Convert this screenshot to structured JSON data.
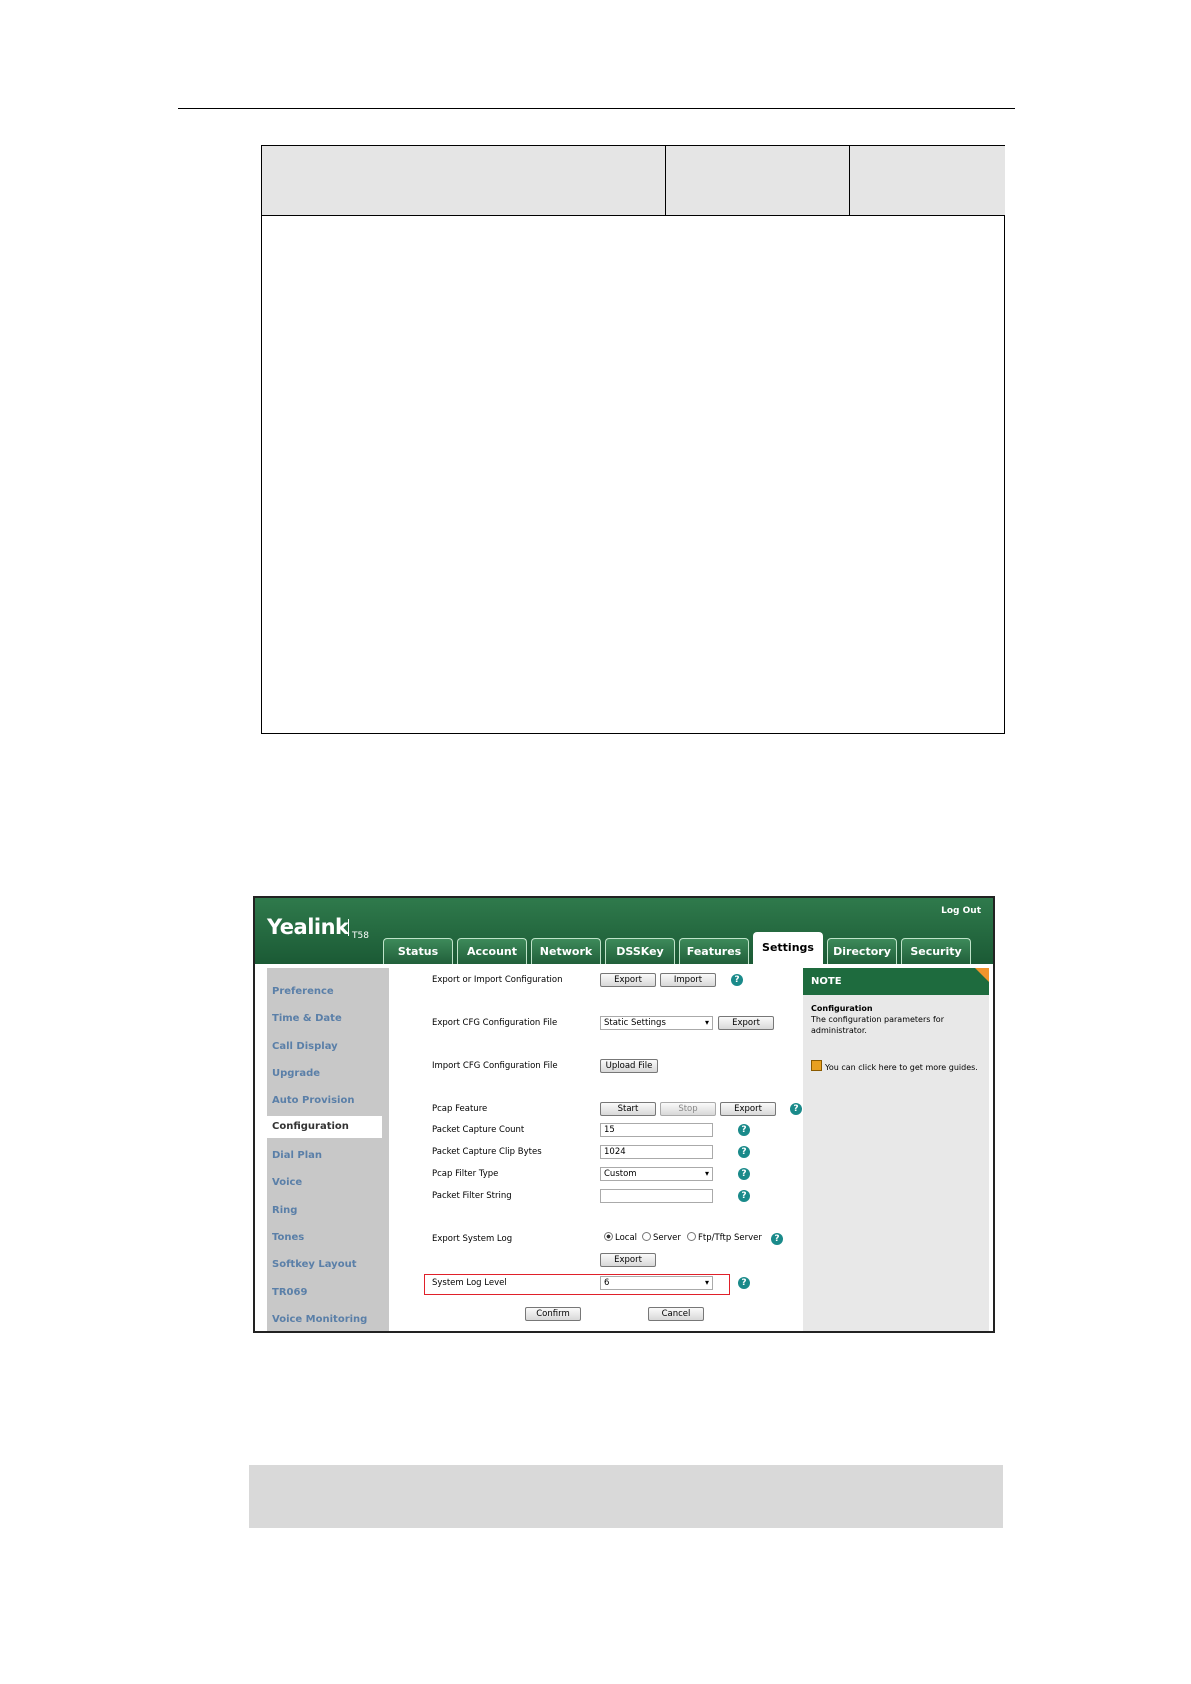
{
  "ui": {
    "logo": "Yealink",
    "model": "T58",
    "logout": "Log Out",
    "tabs": [
      "Status",
      "Account",
      "Network",
      "DSSKey",
      "Features",
      "Settings",
      "Directory",
      "Security"
    ],
    "active_tab": "Settings",
    "sidebar": [
      "Preference",
      "Time & Date",
      "Call Display",
      "Upgrade",
      "Auto Provision",
      "Configuration",
      "Dial Plan",
      "Voice",
      "Ring",
      "Tones",
      "Softkey Layout",
      "TR069",
      "Voice Monitoring"
    ],
    "active_sidebar": "Configuration",
    "rows": {
      "export_import_label": "Export or Import Configuration",
      "export_btn": "Export",
      "import_btn": "Import",
      "export_cfg_label": "Export CFG Configuration File",
      "export_cfg_select": "Static Settings",
      "export_cfg_btn": "Export",
      "import_cfg_label": "Import CFG Configuration File",
      "upload_btn": "Upload File",
      "pcap_label": "Pcap Feature",
      "start_btn": "Start",
      "stop_btn": "Stop",
      "pcap_export_btn": "Export",
      "capture_count_label": "Packet Capture Count",
      "capture_count_value": "15",
      "clip_bytes_label": "Packet Capture Clip Bytes",
      "clip_bytes_value": "1024",
      "filter_type_label": "Pcap Filter Type",
      "filter_type_value": "Custom",
      "filter_string_label": "Packet Filter String",
      "filter_string_value": "",
      "export_log_label": "Export System Log",
      "radio_local": "Local",
      "radio_server": "Server",
      "radio_ftp": "Ftp/Tftp Server",
      "log_export_btn": "Export",
      "log_level_label": "System Log Level",
      "log_level_value": "6",
      "confirm_btn": "Confirm",
      "cancel_btn": "Cancel"
    },
    "note": {
      "title": "NOTE",
      "heading": "Configuration",
      "text": "The configuration parameters for administrator.",
      "guide": "You can click here to get more guides."
    },
    "help_glyph": "?"
  },
  "colors": {
    "header_green": "#1b5a35",
    "highlight_red": "#e0202a",
    "help_teal": "#1a8a8a",
    "note_corner": "#f0942c"
  }
}
